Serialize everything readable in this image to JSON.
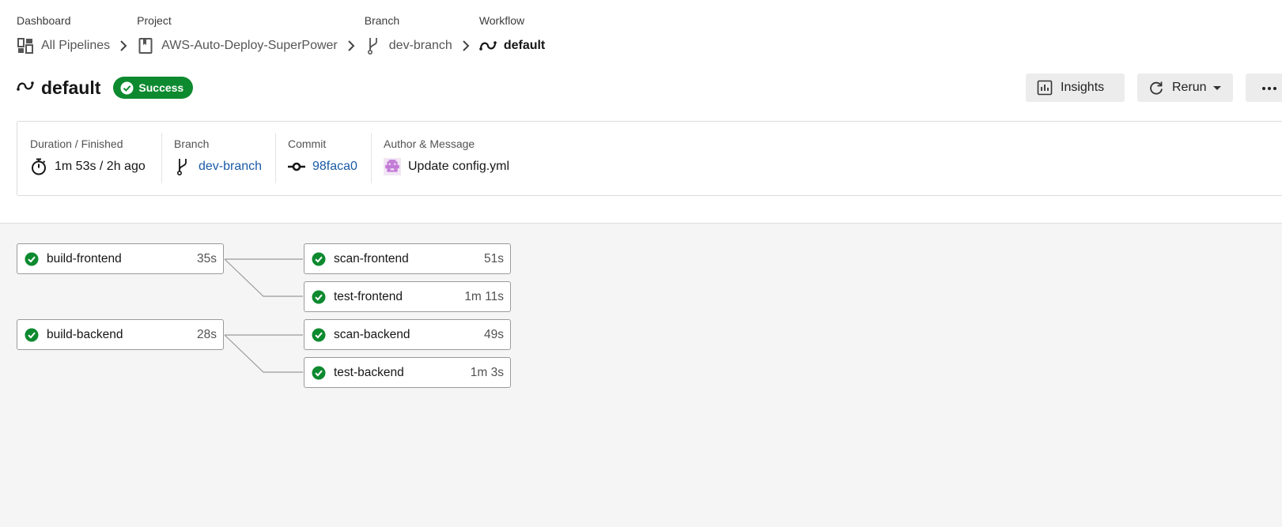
{
  "breadcrumb": {
    "dashboard": {
      "label": "Dashboard",
      "value": "All Pipelines",
      "icon": "dashboard-icon"
    },
    "project": {
      "label": "Project",
      "value": "AWS-Auto-Deploy-SuperPower",
      "icon": "project-icon"
    },
    "branch": {
      "label": "Branch",
      "value": "dev-branch",
      "icon": "branch-icon"
    },
    "workflow": {
      "label": "Workflow",
      "value": "default",
      "icon": "workflow-icon"
    }
  },
  "header": {
    "title": "default",
    "status": "Success",
    "insights_label": "Insights",
    "rerun_label": "Rerun"
  },
  "meta": {
    "duration": {
      "label": "Duration / Finished",
      "value": "1m 53s / 2h ago"
    },
    "branch": {
      "label": "Branch",
      "value": "dev-branch"
    },
    "commit": {
      "label": "Commit",
      "value": "98faca0"
    },
    "author": {
      "label": "Author & Message",
      "value": "Update config.yml"
    }
  },
  "jobs": {
    "build_frontend": {
      "name": "build-frontend",
      "time": "35s"
    },
    "scan_frontend": {
      "name": "scan-frontend",
      "time": "51s"
    },
    "test_frontend": {
      "name": "test-frontend",
      "time": "1m 11s"
    },
    "build_backend": {
      "name": "build-backend",
      "time": "28s"
    },
    "scan_backend": {
      "name": "scan-backend",
      "time": "49s"
    },
    "test_backend": {
      "name": "test-backend",
      "time": "1m 3s"
    }
  },
  "colors": {
    "success": "#0d8a2f",
    "link": "#1b5aa6",
    "canvas": "#f5f5f5"
  }
}
